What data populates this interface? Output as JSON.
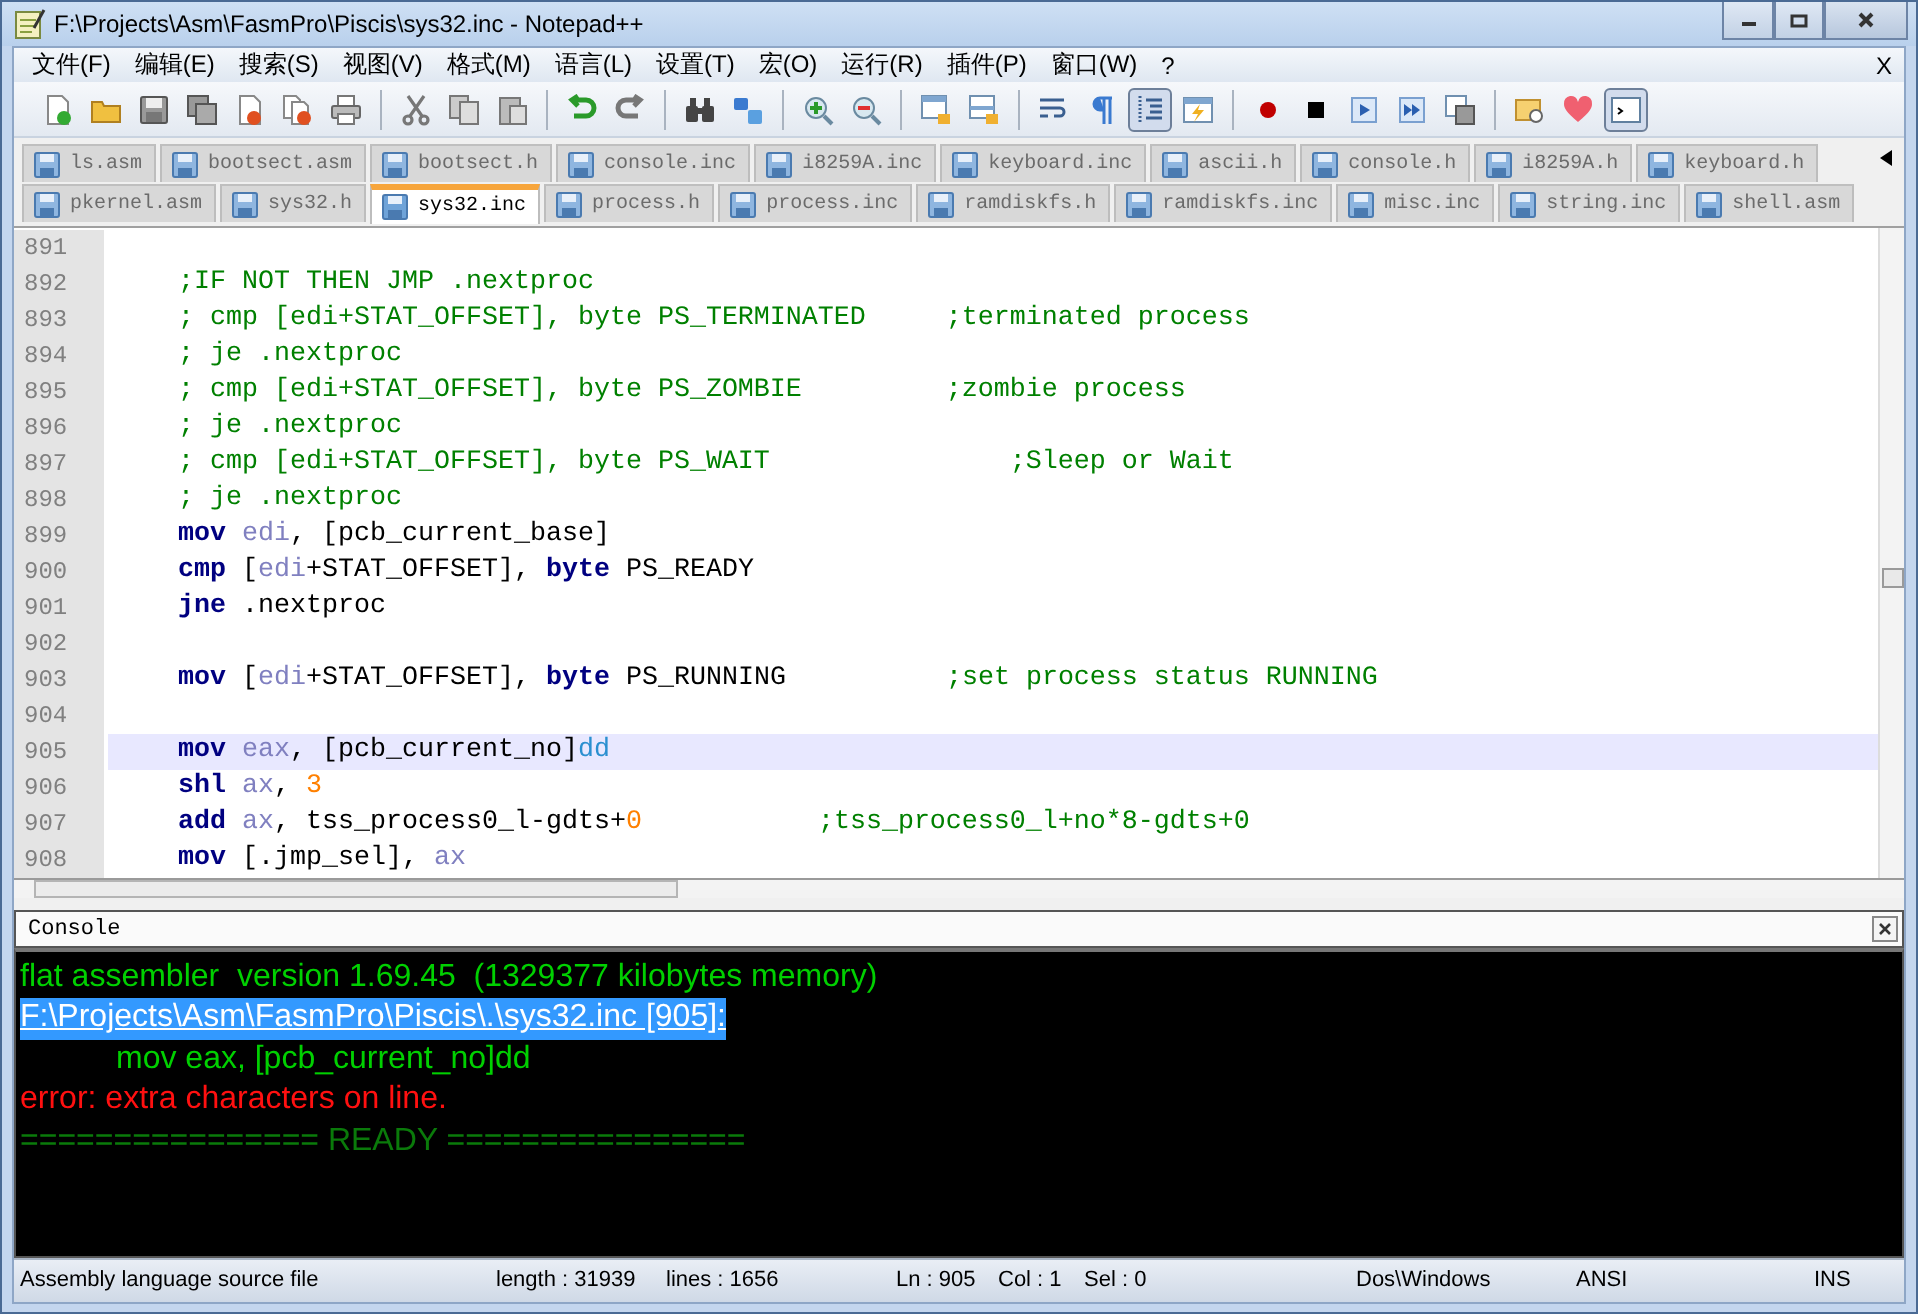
{
  "window": {
    "title": "F:\\Projects\\Asm\\FasmPro\\Piscis\\sys32.inc - Notepad++"
  },
  "menu": [
    "文件(F)",
    "编辑(E)",
    "搜索(S)",
    "视图(V)",
    "格式(M)",
    "语言(L)",
    "设置(T)",
    "宏(O)",
    "运行(R)",
    "插件(P)",
    "窗口(W)",
    "?"
  ],
  "menu_close": "X",
  "toolbar": {
    "groups": [
      [
        {
          "selected": false
        },
        {
          "selected": false
        },
        {
          "selected": false
        },
        {
          "selected": false
        },
        {
          "selected": false
        },
        {
          "selected": false
        },
        {
          "selected": false
        }
      ],
      [
        {
          "selected": false
        },
        {
          "selected": false
        },
        {
          "selected": false
        }
      ],
      [
        {
          "selected": false
        },
        {
          "selected": false
        }
      ],
      [
        {
          "selected": false
        },
        {
          "selected": false
        }
      ],
      [
        {
          "selected": false
        },
        {
          "selected": false
        }
      ],
      [
        {
          "selected": false
        },
        {
          "selected": false
        }
      ],
      [
        {
          "selected": false
        },
        {
          "selected": false
        },
        {
          "selected": true
        },
        {
          "selected": false
        }
      ],
      [
        {
          "selected": false
        },
        {
          "selected": false
        },
        {
          "selected": false
        },
        {
          "selected": false
        },
        {
          "selected": false
        }
      ],
      [
        {
          "selected": false
        },
        {
          "selected": false
        },
        {
          "selected": true
        }
      ]
    ]
  },
  "tab_rows": [
    [
      {
        "label": "ls.asm",
        "selected": false
      },
      {
        "label": "bootsect.asm",
        "selected": false
      },
      {
        "label": "bootsect.h",
        "selected": false
      },
      {
        "label": "console.inc",
        "selected": false
      },
      {
        "label": "i8259A.inc",
        "selected": false
      },
      {
        "label": "keyboard.inc",
        "selected": false
      },
      {
        "label": "ascii.h",
        "selected": false
      },
      {
        "label": "console.h",
        "selected": false
      },
      {
        "label": "i8259A.h",
        "selected": false
      },
      {
        "label": "keyboard.h",
        "selected": false
      }
    ],
    [
      {
        "label": "pkernel.asm",
        "selected": false
      },
      {
        "label": "sys32.h",
        "selected": false
      },
      {
        "label": "sys32.inc",
        "selected": true
      },
      {
        "label": "process.h",
        "selected": false
      },
      {
        "label": "process.inc",
        "selected": false
      },
      {
        "label": "ramdiskfs.h",
        "selected": false
      },
      {
        "label": "ramdiskfs.inc",
        "selected": false
      },
      {
        "label": "misc.inc",
        "selected": false
      },
      {
        "label": "string.inc",
        "selected": false
      },
      {
        "label": "shell.asm",
        "selected": false
      }
    ]
  ],
  "editor": {
    "lines": [
      {
        "number": "891",
        "current": false
      },
      {
        "number": "892",
        "current": false,
        "tokens": [
          {
            "kind": "comment",
            "text": ";IF NOT THEN JMP .nextproc"
          }
        ]
      },
      {
        "number": "893",
        "current": false,
        "tokens": [
          {
            "kind": "comment",
            "text": "; cmp [edi+STAT_OFFSET], byte PS_TERMINATED     ;terminated process"
          }
        ]
      },
      {
        "number": "894",
        "current": false,
        "tokens": [
          {
            "kind": "comment",
            "text": "; je .nextproc"
          }
        ]
      },
      {
        "number": "895",
        "current": false,
        "tokens": [
          {
            "kind": "comment",
            "text": "; cmp [edi+STAT_OFFSET], byte PS_ZOMBIE         ;zombie process"
          }
        ]
      },
      {
        "number": "896",
        "current": false,
        "tokens": [
          {
            "kind": "comment",
            "text": "; je .nextproc"
          }
        ]
      },
      {
        "number": "897",
        "current": false,
        "tokens": [
          {
            "kind": "comment",
            "text": "; cmp [edi+STAT_OFFSET], byte PS_WAIT               ;Sleep or Wait"
          }
        ]
      },
      {
        "number": "898",
        "current": false,
        "tokens": [
          {
            "kind": "comment",
            "text": "; je .nextproc"
          }
        ]
      },
      {
        "number": "899",
        "current": false,
        "tokens": [
          {
            "kind": "keyword",
            "text": "mov"
          },
          {
            "kind": "register",
            "text": " edi"
          },
          {
            "kind": "plain",
            "text": ", [pcb_current_base]"
          }
        ]
      },
      {
        "number": "900",
        "current": false,
        "tokens": [
          {
            "kind": "keyword",
            "text": "cmp"
          },
          {
            "kind": "plain",
            "text": " ["
          },
          {
            "kind": "register",
            "text": "edi"
          },
          {
            "kind": "plain",
            "text": "+STAT_OFFSET], "
          },
          {
            "kind": "keyword",
            "text": "byte"
          },
          {
            "kind": "plain",
            "text": " PS_READY"
          }
        ]
      },
      {
        "number": "901",
        "current": false,
        "tokens": [
          {
            "kind": "keyword",
            "text": "jne"
          },
          {
            "kind": "plain",
            "text": " .nextproc"
          }
        ]
      },
      {
        "number": "902",
        "current": false
      },
      {
        "number": "903",
        "current": false,
        "tokens": [
          {
            "kind": "keyword",
            "text": "mov"
          },
          {
            "kind": "plain",
            "text": " ["
          },
          {
            "kind": "register",
            "text": "edi"
          },
          {
            "kind": "plain",
            "text": "+STAT_OFFSET], "
          },
          {
            "kind": "keyword",
            "text": "byte"
          },
          {
            "kind": "plain",
            "text": " PS_RUNNING"
          },
          {
            "kind": "comment",
            "text": "          ;set process status RUNNING"
          }
        ]
      },
      {
        "number": "904",
        "current": false
      },
      {
        "number": "905",
        "current": true,
        "tokens": [
          {
            "kind": "keyword",
            "text": "mov"
          },
          {
            "kind": "register",
            "text": " eax"
          },
          {
            "kind": "plain",
            "text": ", [pcb_current_no]"
          },
          {
            "kind": "directive",
            "text": "dd"
          }
        ]
      },
      {
        "number": "906",
        "current": false,
        "tokens": [
          {
            "kind": "keyword",
            "text": "shl"
          },
          {
            "kind": "register",
            "text": " ax"
          },
          {
            "kind": "plain",
            "text": ", "
          },
          {
            "kind": "number",
            "text": "3"
          }
        ]
      },
      {
        "number": "907",
        "current": false,
        "tokens": [
          {
            "kind": "keyword",
            "text": "add"
          },
          {
            "kind": "register",
            "text": " ax"
          },
          {
            "kind": "plain",
            "text": ", tss_process0_l-gdts+"
          },
          {
            "kind": "number",
            "text": "0"
          },
          {
            "kind": "comment",
            "text": "           ;tss_process0_l+no*8-gdts+0"
          }
        ]
      },
      {
        "number": "908",
        "current": false,
        "tokens": [
          {
            "kind": "keyword",
            "text": "mov"
          },
          {
            "kind": "plain",
            "text": " [.jmp_sel], "
          },
          {
            "kind": "register",
            "text": "ax"
          }
        ]
      }
    ]
  },
  "console": {
    "title": "Console",
    "lines": [
      {
        "kind": "info",
        "text": "flat assembler  version 1.69.45  (1329377 kilobytes memory)",
        "selected": false
      },
      {
        "kind": "location",
        "text": "F:\\Projects\\Asm\\FasmPro\\Piscis\\.\\sys32.inc [905]:",
        "selected": true
      },
      {
        "kind": "source",
        "text": "mov eax, [pcb_current_no]dd",
        "selected": false
      },
      {
        "kind": "error",
        "text": "error: extra characters on line.",
        "selected": false
      },
      {
        "kind": "status",
        "text": "================ READY ================",
        "selected": false
      }
    ]
  },
  "status_bar": {
    "file_type": "Assembly language source file",
    "length": "length : 31939",
    "lines": "lines : 1656",
    "ln": "Ln : 905",
    "col": "Col : 1",
    "sel": "Sel : 0",
    "eol": "Dos\\Windows",
    "encoding": "ANSI",
    "mode": "INS"
  }
}
